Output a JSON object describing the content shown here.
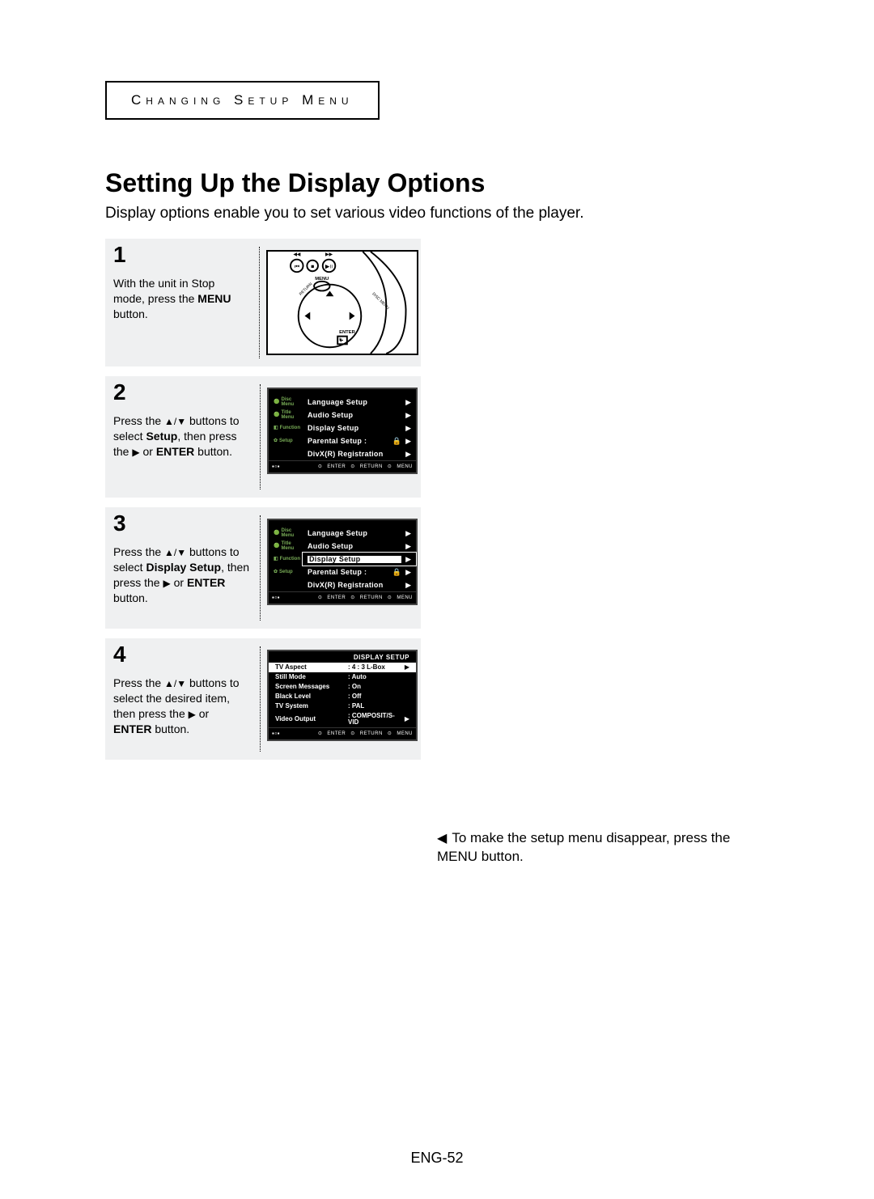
{
  "section_label": "Changing Setup Menu",
  "title": "Setting Up the Display Options",
  "intro": "Display options enable you to set various video functions of the player.",
  "steps": [
    {
      "n": "1",
      "pre": "With the unit in Stop mode, press the ",
      "bold": "MENU",
      "post": " button."
    },
    {
      "n": "2",
      "pre": "Press the ",
      "glyph": "▲/▼",
      "mid": " buttons to select ",
      "bold": "Setup",
      "post1": ", then press the ",
      "glyph2": "▶",
      "post2": " or ",
      "bold2": "ENTER",
      "post3": " button."
    },
    {
      "n": "3",
      "pre": "Press the ",
      "glyph": "▲/▼",
      "mid": " buttons to select ",
      "bold": "Display Setup",
      "post1": ", then press the ",
      "glyph2": "▶",
      "post2": " or ",
      "bold2": "ENTER",
      "post3": " button."
    },
    {
      "n": "4",
      "pre": "Press the ",
      "glyph": "▲/▼",
      "mid": " buttons to select the desired item, then press the ",
      "glyph2": "▶",
      "post2": " or ",
      "bold2": "ENTER",
      "post3": " button."
    }
  ],
  "osd_left_tags": [
    "Disc Menu",
    "Title Menu",
    "Function",
    "Setup"
  ],
  "osd_items": [
    {
      "label": "Language Setup",
      "arrow": "▶"
    },
    {
      "label": "Audio Setup",
      "arrow": "▶"
    },
    {
      "label": "Display Setup",
      "arrow": "▶"
    },
    {
      "label": "Parental Setup :",
      "lock": "🔒",
      "arrow": "▶"
    },
    {
      "label": "DivX(R) Registration",
      "arrow": "▶"
    }
  ],
  "osd_footer": {
    "enter": "ENTER",
    "return": "RETURN",
    "menu": "MENU"
  },
  "display_setup": {
    "title": "DISPLAY SETUP",
    "rows": [
      {
        "k": "TV Aspect",
        "v": ": 4 : 3 L-Box",
        "sel": true,
        "arr": "▶"
      },
      {
        "k": "Still Mode",
        "v": ": Auto"
      },
      {
        "k": "Screen Messages",
        "v": ": On"
      },
      {
        "k": "Black Level",
        "v": ": Off"
      },
      {
        "k": "TV System",
        "v": ": PAL"
      },
      {
        "k": "Video Output",
        "v": ": COMPOSIT/S-VID",
        "arr": "▶"
      }
    ]
  },
  "tip_arrow": "◀",
  "tip": "To make the setup menu disappear, press the MENU button.",
  "remote_label": "ENTER",
  "remote_menu": "MENU",
  "page": "ENG-52"
}
